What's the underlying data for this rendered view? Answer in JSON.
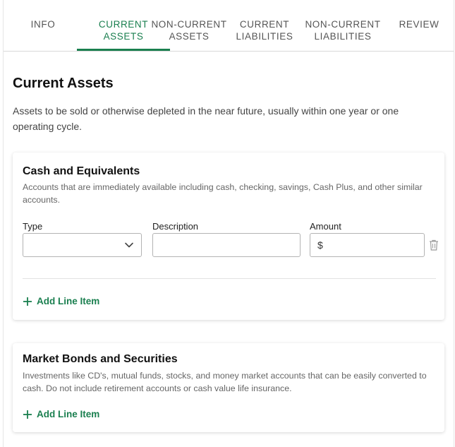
{
  "tabs": [
    {
      "label": "INFO",
      "active": false
    },
    {
      "label": "CURRENT\nASSETS",
      "active": true
    },
    {
      "label": "NON-CURRENT\nASSETS",
      "active": false
    },
    {
      "label": "CURRENT\nLIABILITIES",
      "active": false
    },
    {
      "label": "NON-CURRENT\nLIABILITIES",
      "active": false
    },
    {
      "label": "REVIEW",
      "active": false
    }
  ],
  "page": {
    "title": "Current Assets",
    "intro": "Assets to be sold or otherwise depleted in the near future, usually within one year or one operating cycle."
  },
  "sections": [
    {
      "title": "Cash and Equivalents",
      "description": "Accounts that are immediately available including cash, checking, savings, Cash Plus, and other similar accounts.",
      "fields": {
        "type_label": "Type",
        "type_value": "",
        "description_label": "Description",
        "description_value": "",
        "amount_label": "Amount",
        "amount_prefix": "$",
        "amount_value": ""
      },
      "add_label": "Add Line Item"
    },
    {
      "title": "Market Bonds and Securities",
      "description": "Investments like CD's, mutual funds, stocks, and money market accounts that can be easily converted to cash. Do not include retirement accounts or cash value life insurance.",
      "add_label": "Add Line Item"
    }
  ],
  "colors": {
    "accent": "#1a7f4f",
    "tab_inactive": "#555555",
    "border": "#b3b3b3"
  },
  "icons": {
    "type_dropdown": "chevron-down-icon",
    "delete_row": "trash-icon",
    "add": "plus-icon"
  }
}
